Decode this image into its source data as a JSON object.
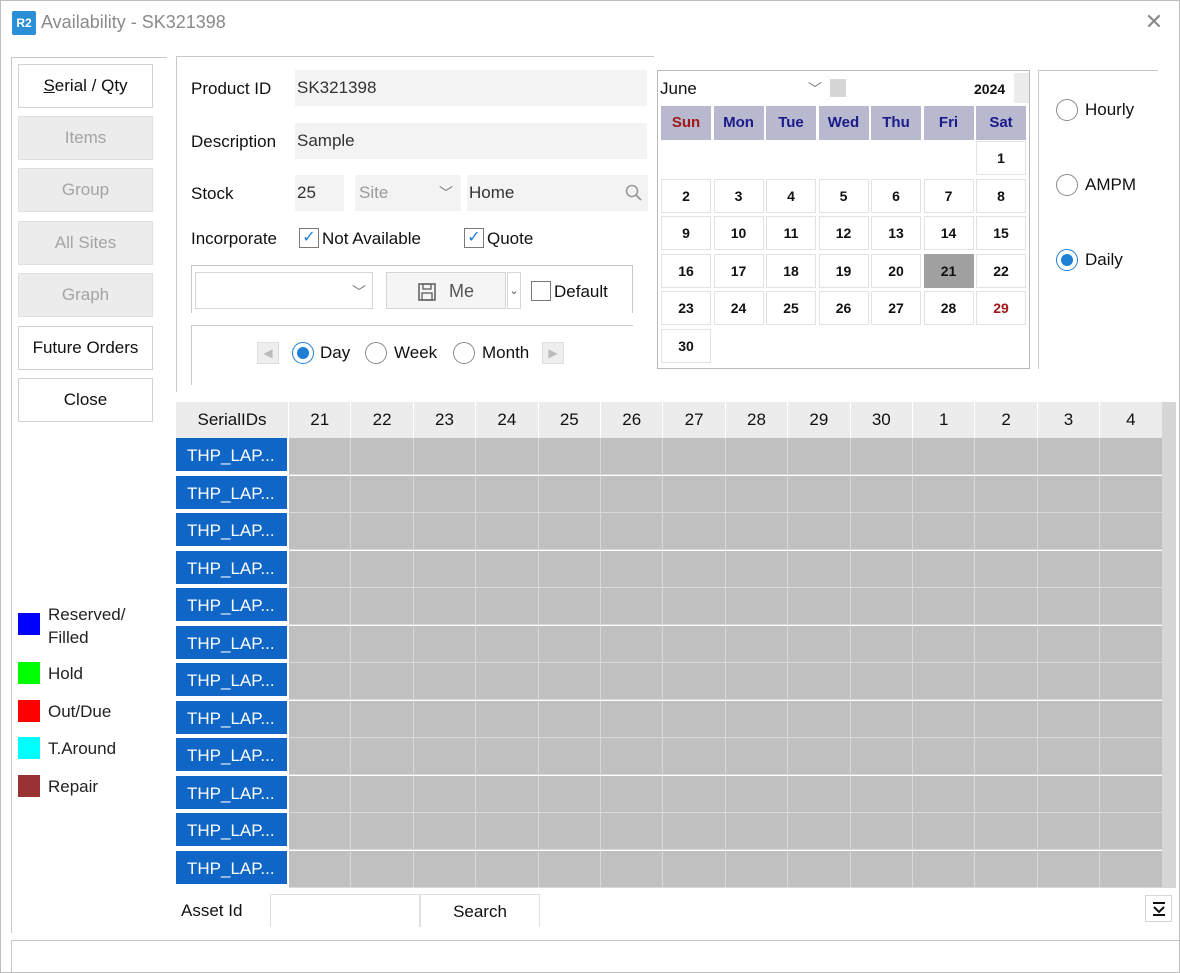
{
  "window": {
    "logo": "R2",
    "title": "Availability - SK321398",
    "close_icon": "close-icon"
  },
  "nav": {
    "serial_qty": "Serial / Qty",
    "items": "Items",
    "group": "Group",
    "all_sites": "All Sites",
    "graph": "Graph",
    "future_orders": "Future Orders",
    "close": "Close"
  },
  "legend": [
    {
      "label_1": "Reserved/",
      "label_2": "Filled",
      "color": "#0000ff"
    },
    {
      "label": "Hold",
      "color": "#00ff00"
    },
    {
      "label": "Out/Due",
      "color": "#ff0000"
    },
    {
      "label": "T.Around",
      "color": "#00ffff"
    },
    {
      "label": "Repair",
      "color": "#993333"
    }
  ],
  "form": {
    "product_id_label": "Product ID",
    "product_id_value": "SK321398",
    "description_label": "Description",
    "description_value": "Sample",
    "stock_label": "Stock",
    "stock_value": "25",
    "site_placeholder": "Site",
    "location_value": "Home",
    "incorporate_label": "Incorporate",
    "not_available_label": "Not Available",
    "not_available_checked": true,
    "quote_label": "Quote",
    "quote_checked": true,
    "view_select_value": "",
    "save_label": "Me",
    "default_label": "Default",
    "default_checked": false
  },
  "view_mode": {
    "options": [
      "Day",
      "Week",
      "Month"
    ],
    "selected": "Day"
  },
  "calendar": {
    "month": "June",
    "year": "2024",
    "weekdays": [
      "Sun",
      "Mon",
      "Tue",
      "Wed",
      "Thu",
      "Fri",
      "Sat"
    ],
    "days": [
      "1",
      "2",
      "3",
      "4",
      "5",
      "6",
      "7",
      "8",
      "9",
      "10",
      "11",
      "12",
      "13",
      "14",
      "15",
      "16",
      "17",
      "18",
      "19",
      "20",
      "21",
      "22",
      "23",
      "24",
      "25",
      "26",
      "27",
      "28",
      "29",
      "30"
    ],
    "first_weekday_index": 6,
    "selected_day": "21",
    "highlight_red_day": "29"
  },
  "period": {
    "options": [
      "Hourly",
      "AMPM",
      "Daily"
    ],
    "selected": "Daily"
  },
  "grid": {
    "header_label": "SerialIDs",
    "columns": [
      "21",
      "22",
      "23",
      "24",
      "25",
      "26",
      "27",
      "28",
      "29",
      "30",
      "1",
      "2",
      "3",
      "4"
    ],
    "rows": [
      "THP_LAP...",
      "THP_LAP...",
      "THP_LAP...",
      "THP_LAP...",
      "THP_LAP...",
      "THP_LAP...",
      "THP_LAP...",
      "THP_LAP...",
      "THP_LAP...",
      "THP_LAP...",
      "THP_LAP...",
      "THP_LAP..."
    ],
    "row_color": "#0f66c6",
    "cell_color": "#c0c0c0"
  },
  "search": {
    "asset_label": "Asset Id",
    "asset_value": "",
    "search_button": "Search",
    "collapse_icon": "collapse-down-icon"
  }
}
